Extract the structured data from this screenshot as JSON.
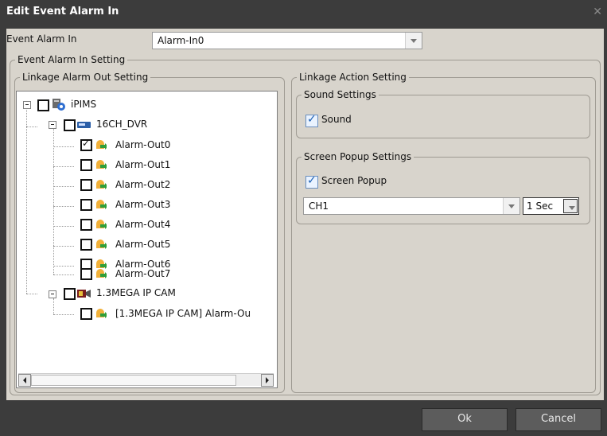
{
  "window": {
    "title": "Edit Event Alarm In",
    "close_glyph": "✕"
  },
  "event_alarm_in": {
    "label": "Event Alarm In",
    "value": "Alarm-In0"
  },
  "groups": {
    "event_alarm_in_setting": "Event Alarm In Setting",
    "linkage_alarm_out": "Linkage Alarm Out Setting",
    "linkage_action": "Linkage Action Setting",
    "sound_settings": "Sound Settings",
    "screen_popup_settings": "Screen Popup Settings"
  },
  "tree": {
    "root": "iPIMS",
    "dvr": "16CH_DVR",
    "dvr_outputs": [
      "Alarm-Out0",
      "Alarm-Out1",
      "Alarm-Out2",
      "Alarm-Out3",
      "Alarm-Out4",
      "Alarm-Out5",
      "Alarm-Out6",
      "Alarm-Out7"
    ],
    "dvr_checked": [
      true,
      false,
      false,
      false,
      false,
      false,
      false,
      false
    ],
    "cam": "1.3MEGA IP CAM",
    "cam_output": "[1.3MEGA IP CAM] Alarm-Ou"
  },
  "sound": {
    "label": "Sound",
    "checked": true
  },
  "popup": {
    "label": "Screen Popup",
    "checked": true,
    "channel": "CH1",
    "duration": "1 Sec"
  },
  "buttons": {
    "ok": "Ok",
    "cancel": "Cancel"
  }
}
